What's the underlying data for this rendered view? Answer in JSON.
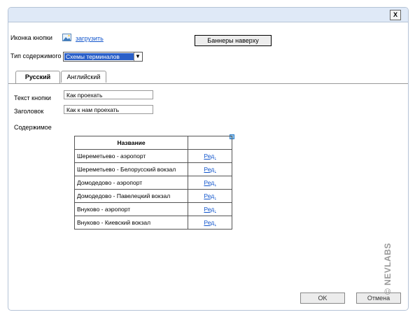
{
  "dialog": {
    "close_label": "X"
  },
  "form": {
    "icon_label": "Иконка кнопки",
    "upload_link": "загрузить",
    "banners_button": "Баннеры наверху",
    "content_type_label": "Тип содержимого",
    "content_type_value": "Схемы терминалов",
    "tabs": [
      {
        "label": "Русский",
        "active": true
      },
      {
        "label": "Английский",
        "active": false
      }
    ],
    "button_text_label": "Текст кнопки",
    "button_text_value": "Как проехать",
    "heading_label": "Заголовок",
    "heading_value": "Как к нам проехать",
    "content_label": "Содержимое"
  },
  "table": {
    "header": "Название",
    "rows": [
      {
        "name": "Шереметьево - аэропорт",
        "action": "Ред."
      },
      {
        "name": "Шереметьево - Белорусский вокзал",
        "action": "Ред."
      },
      {
        "name": "Домодедово - аэропорт",
        "action": "Ред."
      },
      {
        "name": "Домодедово - Павелецкий вокзал",
        "action": "Ред."
      },
      {
        "name": "Внуково - аэропорт",
        "action": "Ред."
      },
      {
        "name": "Внуково - Киевский вокзал",
        "action": "Ред."
      }
    ]
  },
  "footer": {
    "ok_label": "OK",
    "cancel_label": "Отмена"
  },
  "watermark": "© NEVLABS"
}
